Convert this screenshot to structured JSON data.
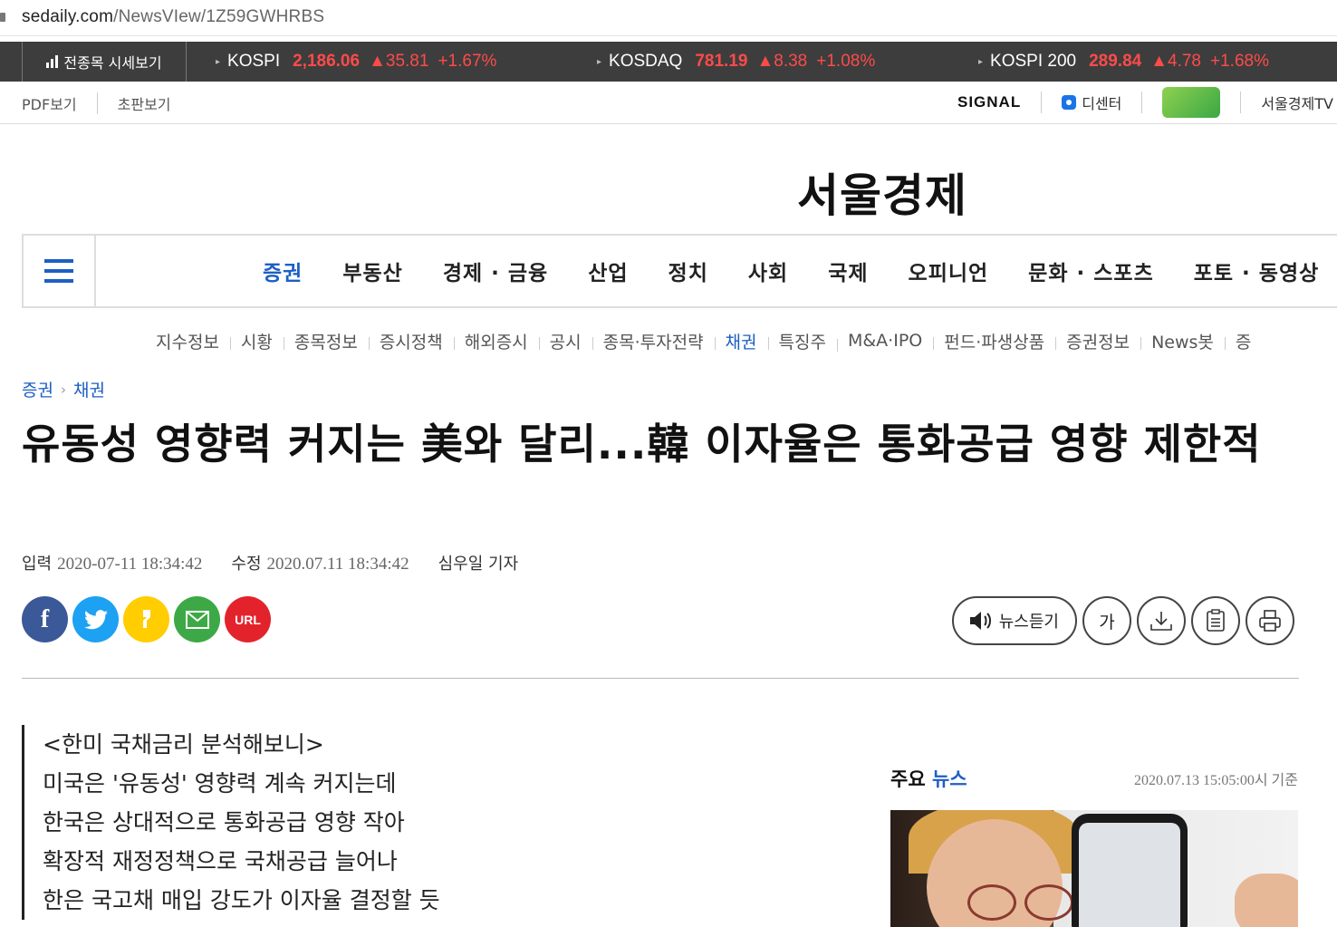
{
  "browser": {
    "url_host": "sedaily.com",
    "url_path": "/NewsVIew/1Z59GWHRBS"
  },
  "ticker": {
    "button_label": "전종목 시세보기",
    "items": [
      {
        "name": "KOSPI",
        "value": "2,186.06",
        "change": "▲35.81",
        "pct": "+1.67%"
      },
      {
        "name": "KOSDAQ",
        "value": "781.19",
        "change": "▲8.38",
        "pct": "+1.08%"
      },
      {
        "name": "KOSPI 200",
        "value": "289.84",
        "change": "▲4.78",
        "pct": "+1.68%"
      }
    ],
    "up_color": "#ff4a4a"
  },
  "util": {
    "left": [
      "PDF보기",
      "초판보기"
    ],
    "signal": "SIGNAL",
    "dcenter": "디센터",
    "tv": "서울경제TV"
  },
  "logo": "서울경제",
  "nav": {
    "items": [
      "증권",
      "부동산",
      "경제 · 금융",
      "산업",
      "정치",
      "사회",
      "국제",
      "오피니언",
      "문화 · 스포츠",
      "포토 · 동영상"
    ],
    "active_index": 0
  },
  "subnav": {
    "items": [
      "지수정보",
      "시황",
      "종목정보",
      "증시정책",
      "해외증시",
      "공시",
      "종목·투자전략",
      "채권",
      "특징주",
      "M&A·IPO",
      "펀드·파생상품",
      "증권정보",
      "News봇",
      "증"
    ],
    "active_index": 7
  },
  "breadcrumb": [
    "증권",
    "채권"
  ],
  "article": {
    "headline": "유동성 영향력 커지는 美와 달리...韓 이자율은 통화공급 영향 제한적",
    "input_label": "입력",
    "input_date": "2020-07-11 18:34:42",
    "edit_label": "수정",
    "edit_date": "2020.07.11 18:34:42",
    "reporter": "심우일 기자",
    "summary": [
      "<한미 국채금리 분석해보니>",
      "미국은 '유동성' 영향력 계속 커지는데",
      "한국은 상대적으로 통화공급 영향 작아",
      "확장적 재정정책으로 국채공급 늘어나",
      "한은 국고채 매입 강도가 이자율 결정할 듯"
    ]
  },
  "share": {
    "url_label": "URL"
  },
  "tools": {
    "listen_label": "뉴스듣기",
    "font_label": "가"
  },
  "side": {
    "title_prefix": "주요",
    "title_accent": "뉴스",
    "timestamp": "2020.07.13 15:05:00시 기준"
  }
}
